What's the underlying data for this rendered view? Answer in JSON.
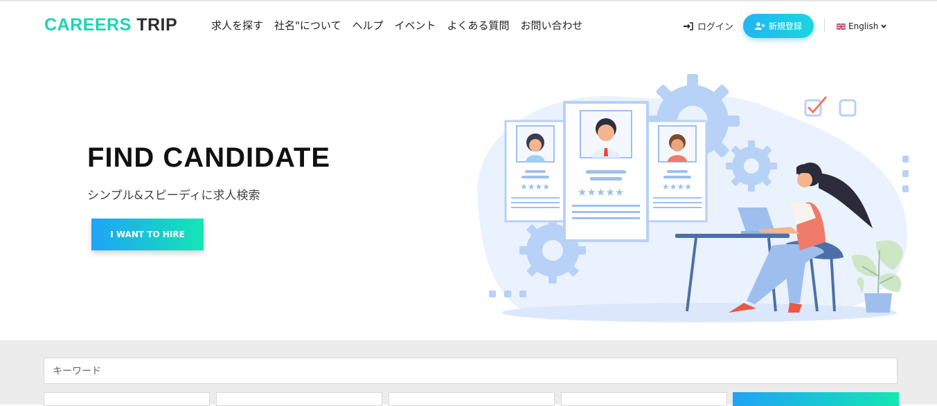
{
  "header": {
    "logo_part1": "CAREERS",
    "logo_part2": "TRIP",
    "nav": [
      "求人を探す",
      "社名\"について",
      "ヘルプ",
      "イベント",
      "よくある質問",
      "お問い合わせ"
    ],
    "login_label": "ログイン",
    "signup_label": "新規登録",
    "language_label": "English"
  },
  "hero": {
    "title": "FIND CANDIDATE",
    "subtitle": "シンプル&スピーディに求人検索",
    "cta_label": "I WANT TO HIRE"
  },
  "search": {
    "keyword_placeholder": "キーワード"
  },
  "colors": {
    "brand_teal": "#1dd3b0",
    "signup_gradient": [
      "#22b6f0",
      "#1ad6e0"
    ],
    "cta_gradient": [
      "#1fa3f7",
      "#14e6b4"
    ],
    "band_bg": "#ececec"
  },
  "icons": [
    "sign-in-icon",
    "user-plus-icon",
    "uk-flag-icon",
    "chevron-down-icon"
  ]
}
